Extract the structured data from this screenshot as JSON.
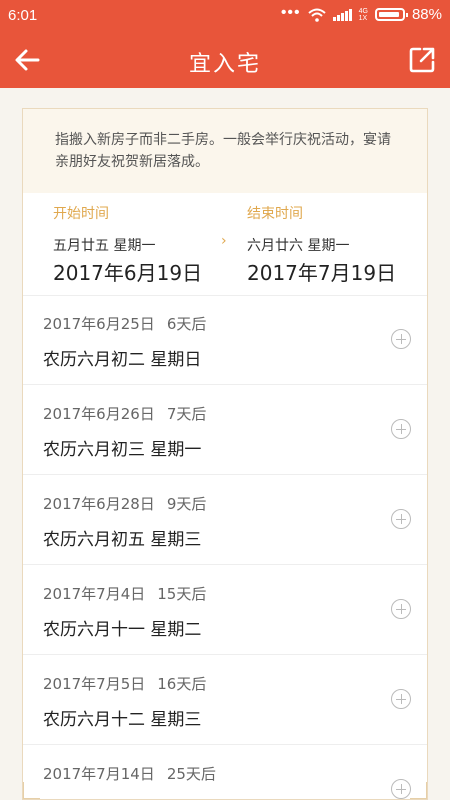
{
  "status_bar": {
    "time": "6:01",
    "network_top": "4G",
    "network_bottom": "1X",
    "battery": "88%"
  },
  "header": {
    "title": "宜入宅",
    "back_icon": "arrow-left-icon",
    "share_icon": "share-icon"
  },
  "description": "指搬入新房子而非二手房。一般会举行庆祝活动，宴请亲朋好友祝贺新居落成。",
  "range": {
    "start_label": "开始时间",
    "start_lunar": "五月廿五 星期一",
    "start_date": "2017年6月19日",
    "end_label": "结束时间",
    "end_lunar": "六月廿六 星期一",
    "end_date": "2017年7月19日",
    "arrow": "›"
  },
  "days": [
    {
      "date": "2017年6月25日",
      "after": "6天后",
      "lunar": "农历六月初二 星期日"
    },
    {
      "date": "2017年6月26日",
      "after": "7天后",
      "lunar": "农历六月初三 星期一"
    },
    {
      "date": "2017年6月28日",
      "after": "9天后",
      "lunar": "农历六月初五 星期三"
    },
    {
      "date": "2017年7月4日",
      "after": "15天后",
      "lunar": "农历六月十一 星期二"
    },
    {
      "date": "2017年7月5日",
      "after": "16天后",
      "lunar": "农历六月十二 星期三"
    },
    {
      "date": "2017年7月14日",
      "after": "25天后",
      "lunar": ""
    }
  ],
  "colors": {
    "brand": "#e8553a",
    "accent": "#e0a84e"
  }
}
